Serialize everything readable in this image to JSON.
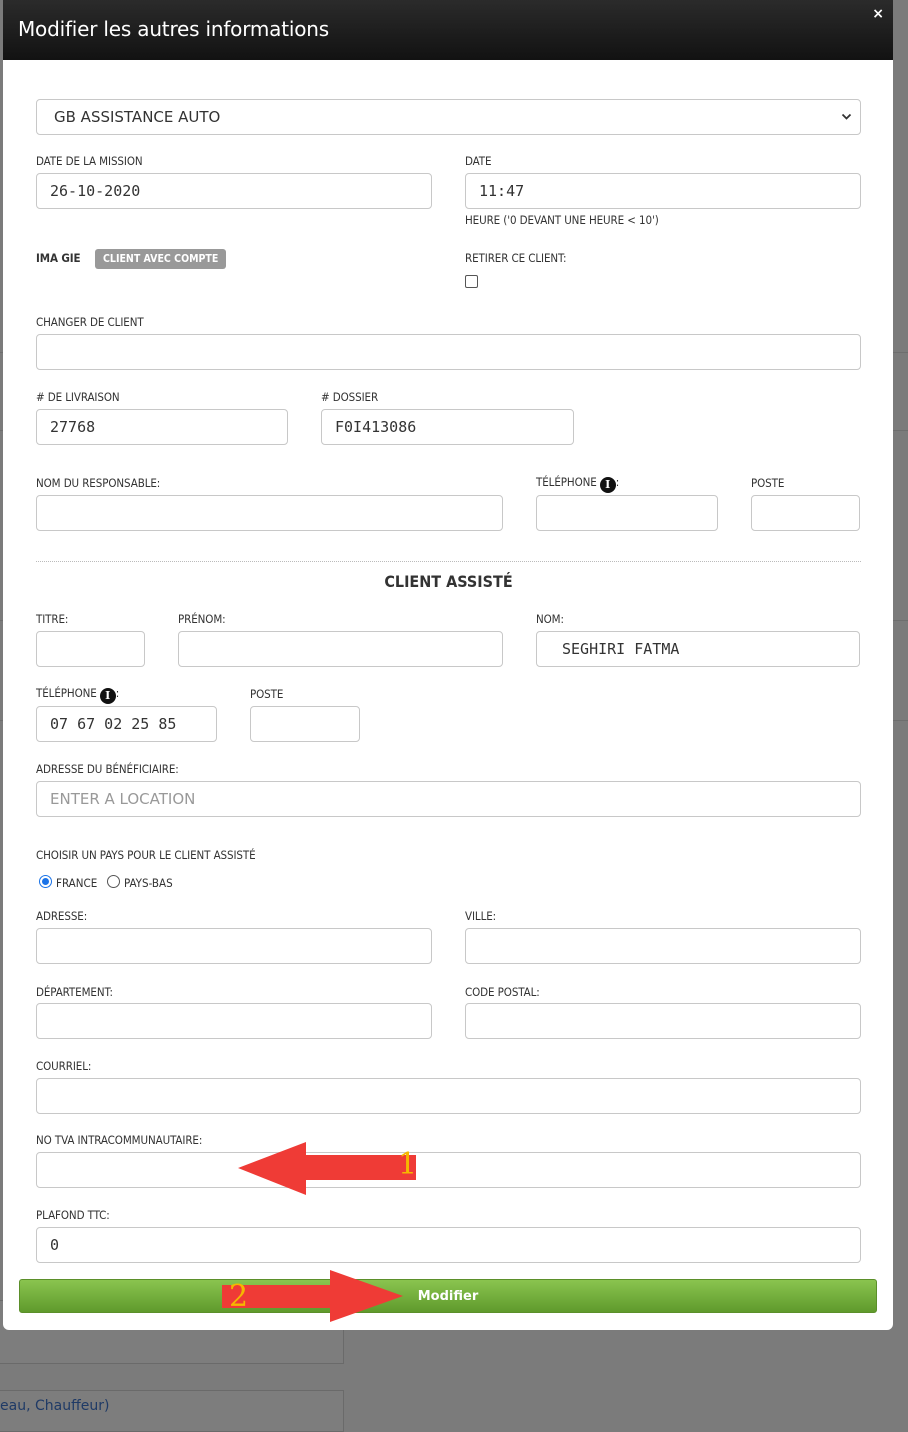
{
  "modal": {
    "title": "Modifier les autres informations",
    "close_label": "×"
  },
  "company_select": {
    "value": "GB ASSISTANCE AUTO"
  },
  "mission": {
    "date_label": "DATE DE LA MISSION",
    "date_value": "26-10-2020",
    "time_label": "DATE",
    "time_value": "11:47",
    "time_help": "HEURE ('0 DEVANT UNE HEURE < 10')"
  },
  "client": {
    "name": "IMA GIE",
    "badge": "CLIENT AVEC COMPTE",
    "remove_label": "RETIRER CE CLIENT:",
    "remove_checked": false,
    "change_label": "CHANGER DE CLIENT",
    "change_value": ""
  },
  "refs": {
    "delivery_label": "# DE LIVRAISON",
    "delivery_value": "27768",
    "dossier_label": "# DOSSIER",
    "dossier_value": "F0I413086"
  },
  "responsable": {
    "name_label": "NOM DU RESPONSABLE:",
    "phone_label": "TÉLÉPHONE",
    "phone_suffix": ":",
    "poste_label": "POSTE"
  },
  "assisted": {
    "section_title": "CLIENT ASSISTÉ",
    "titre_label": "TITRE:",
    "prenom_label": "PRÉNOM:",
    "nom_label": "NOM:",
    "nom_value": "SEGHIRI FATMA",
    "phone_label": "TÉLÉPHONE",
    "phone_suffix": ":",
    "phone_value": "07 67 02 25 85",
    "poste_label": "POSTE",
    "address_label": "ADRESSE DU BÉNÉFICIAIRE:",
    "address_placeholder": "ENTER A LOCATION",
    "country_label": "CHOISIR UN PAYS POUR LE CLIENT ASSISTÉ",
    "country_options": [
      "FRANCE",
      "PAYS-BAS"
    ],
    "country_selected": "FRANCE",
    "adresse_label": "ADRESSE:",
    "ville_label": "VILLE:",
    "departement_label": "DÉPARTEMENT:",
    "code_postal_label": "CODE POSTAL:",
    "courriel_label": "COURRIEL:",
    "tva_label": "NO TVA INTRACOMMUNAUTAIRE:",
    "plafond_label": "PLAFOND TTC:",
    "plafond_value": "0"
  },
  "actions": {
    "submit_label": "Modifier"
  },
  "annotations": [
    {
      "number": "1",
      "color": "#f04040"
    },
    {
      "number": "2",
      "color": "#f04040"
    }
  ],
  "background": {
    "link_text": "eau, Chauffeur)"
  },
  "icons": {
    "info": "info-icon",
    "close": "close-icon",
    "chevron": "chevron-down-icon"
  }
}
